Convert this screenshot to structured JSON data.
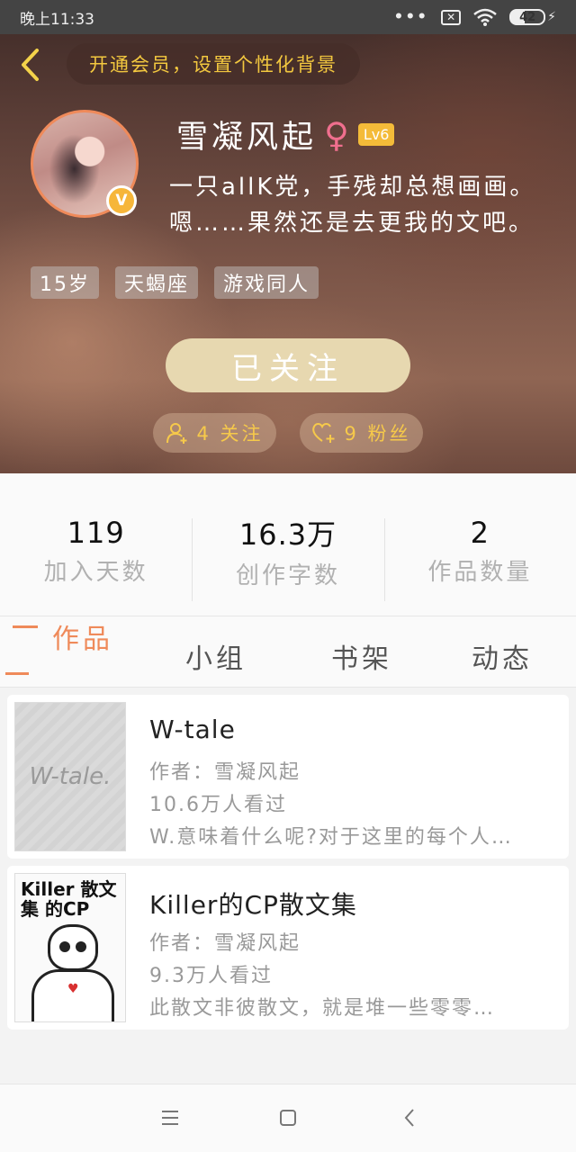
{
  "status_bar": {
    "time": "晚上11:33",
    "battery": "42"
  },
  "header": {
    "vip_banner": "开通会员，设置个性化背景",
    "username": "雪凝风起",
    "gender_symbol": "♀",
    "level": "Lv6",
    "verified_badge": "V",
    "bio": "一只allK党，手残却总想画画。嗯……果然还是去更我的文吧。",
    "tags": [
      "15岁",
      "天蝎座",
      "游戏同人"
    ],
    "follow_button": "已关注",
    "following_label": "4 关注",
    "fans_label": "9 粉丝"
  },
  "stats": [
    {
      "value": "119",
      "label": "加入天数"
    },
    {
      "value": "16.3万",
      "label": "创作字数"
    },
    {
      "value": "2",
      "label": "作品数量"
    }
  ],
  "tabs": {
    "works": "作品",
    "group": "小组",
    "shelf": "书架",
    "dynamic": "动态",
    "active": "works"
  },
  "works": [
    {
      "title": "W-tale",
      "author": "作者：雪凝风起",
      "views": "10.6万人看过",
      "desc": "W.意味着什么呢?对于这里的每个人…",
      "cover_text": "W-tale."
    },
    {
      "title": "Killer的CP散文集",
      "author": "作者：雪凝风起",
      "views": "9.3万人看过",
      "desc": "此散文非彼散文，就是堆一些零零…",
      "cover_text": "Killer 散文集 的CP"
    }
  ],
  "colors": {
    "accent": "#ef8a5a",
    "gold": "#f3c83f",
    "follow_button": "#e7d8b0",
    "level_badge": "#f4bb39"
  }
}
